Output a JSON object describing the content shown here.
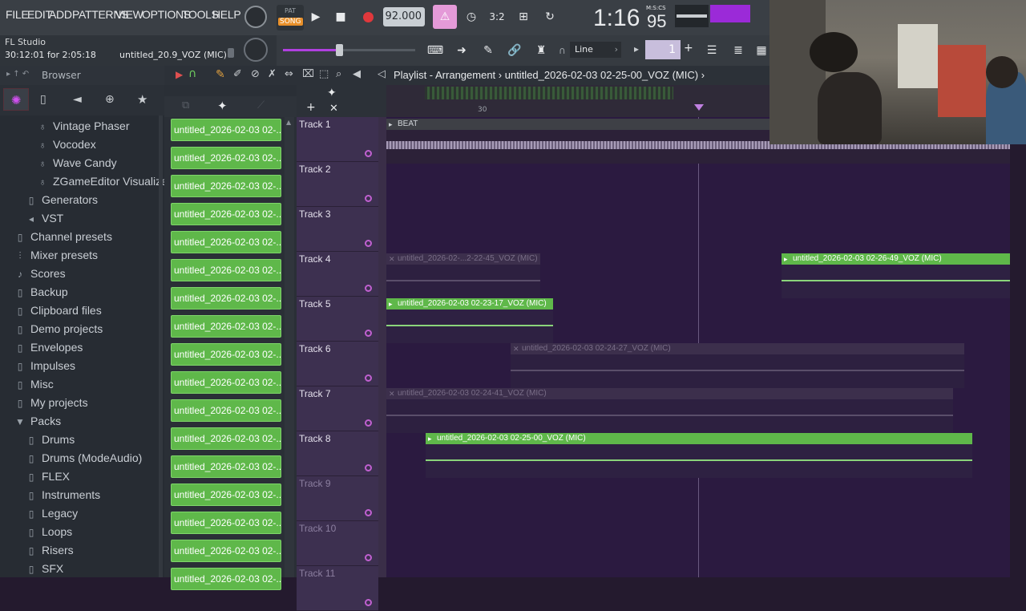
{
  "menu": [
    "FILE",
    "EDIT",
    "ADD",
    "PATTERNS",
    "VIEW",
    "OPTIONS",
    "TOOLS",
    "HELP"
  ],
  "transport": {
    "pat_label": "PAT",
    "song_label": "SONG",
    "tempo": "92.000",
    "time_main": "1:16",
    "time_frac": "95",
    "time_format": "M:S:CS",
    "pattern_number": "1",
    "snap": "Line"
  },
  "hint": {
    "app": "FL Studio",
    "time": "30:12:01 for 2:05:18",
    "project": "untitled_20.9_VOZ (MIC)"
  },
  "browser": {
    "title": "Browser",
    "items": [
      {
        "label": "Vintage Phaser",
        "icon": "plugin-icon",
        "indent": 2
      },
      {
        "label": "Vocodex",
        "icon": "plugin-icon",
        "indent": 2
      },
      {
        "label": "Wave Candy",
        "icon": "plugin-icon",
        "indent": 2
      },
      {
        "label": "ZGameEditor Visualizer",
        "icon": "plugin-icon",
        "indent": 2
      },
      {
        "label": "Generators",
        "icon": "folder-icon",
        "indent": 1
      },
      {
        "label": "VST",
        "icon": "plug-icon",
        "indent": 1
      },
      {
        "label": "Channel presets",
        "icon": "folder-icon",
        "indent": 0
      },
      {
        "label": "Mixer presets",
        "icon": "mixer-icon",
        "indent": 0
      },
      {
        "label": "Scores",
        "icon": "note-icon",
        "indent": 0
      },
      {
        "label": "Backup",
        "icon": "folder-icon",
        "indent": 0
      },
      {
        "label": "Clipboard files",
        "icon": "folder-icon",
        "indent": 0
      },
      {
        "label": "Demo projects",
        "icon": "folder-icon",
        "indent": 0
      },
      {
        "label": "Envelopes",
        "icon": "folder-icon",
        "indent": 0
      },
      {
        "label": "Impulses",
        "icon": "folder-icon",
        "indent": 0
      },
      {
        "label": "Misc",
        "icon": "folder-icon",
        "indent": 0
      },
      {
        "label": "My projects",
        "icon": "folder-icon",
        "indent": 0
      },
      {
        "label": "Packs",
        "icon": "folder-open-icon",
        "indent": 0
      },
      {
        "label": "Drums",
        "icon": "folder-icon",
        "indent": 1
      },
      {
        "label": "Drums (ModeAudio)",
        "icon": "folder-icon",
        "indent": 1
      },
      {
        "label": "FLEX",
        "icon": "folder-icon",
        "indent": 1
      },
      {
        "label": "Instruments",
        "icon": "folder-icon",
        "indent": 1
      },
      {
        "label": "Legacy",
        "icon": "folder-icon",
        "indent": 1
      },
      {
        "label": "Loops",
        "icon": "folder-icon",
        "indent": 1
      },
      {
        "label": "Risers",
        "icon": "folder-icon",
        "indent": 1
      },
      {
        "label": "SFX",
        "icon": "folder-icon",
        "indent": 1
      }
    ]
  },
  "picker": {
    "pattern_label": "untitled_2026-02-03 02-...",
    "count": 17
  },
  "playlist": {
    "title": "Playlist - Arrangement",
    "project": "untitled_2026-02-03 02-25-00_VOZ (MIC)",
    "bar_number": "30",
    "tracks": [
      "Track 1",
      "Track 2",
      "Track 3",
      "Track 4",
      "Track 5",
      "Track 6",
      "Track 7",
      "Track 8",
      "Track 9",
      "Track 10",
      "Track 11"
    ],
    "clips": [
      {
        "name": "BEAT",
        "track": 0,
        "state": "beat"
      },
      {
        "name": "untitled_2026-02-...2-22-45_VOZ (MIC)",
        "track": 3,
        "state": "off"
      },
      {
        "name": "untitled_2026-02-03 02-26-49_VOZ (MIC)",
        "track": 3,
        "state": "on"
      },
      {
        "name": "untitled_2026-02-03 02-23-17_VOZ (MIC)",
        "track": 4,
        "state": "on"
      },
      {
        "name": "untitled_2026-02-03 02-24-27_VOZ (MIC)",
        "track": 5,
        "state": "off"
      },
      {
        "name": "untitled_2026-02-03 02-24-41_VOZ (MIC)",
        "track": 6,
        "state": "off"
      },
      {
        "name": "untitled_2026-02-03 02-25-00_VOZ (MIC)",
        "track": 7,
        "state": "on"
      }
    ]
  },
  "colors": {
    "clip_on": "#5fb84a",
    "clip_off": "#3c2f4c",
    "grid_bg": "#2b1a40",
    "accent": "#c060d0"
  }
}
